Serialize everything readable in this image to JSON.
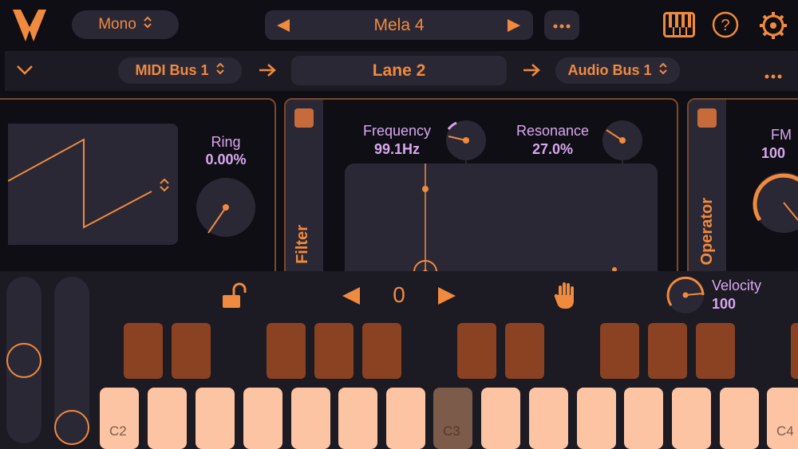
{
  "header": {
    "mode": "Mono",
    "preset": "Mela 4",
    "icons": [
      "logo-icon",
      "piano-icon",
      "help-icon",
      "settings-icon"
    ]
  },
  "routing": {
    "midi_bus": "MIDI Bus 1",
    "lane": "Lane 2",
    "audio_bus": "Audio Bus 1"
  },
  "oscillator": {
    "ring_label": "Ring",
    "ring_value": "0.00%"
  },
  "filter": {
    "section_label": "Filter",
    "frequency_label": "Frequency",
    "frequency_value": "99.1Hz",
    "resonance_label": "Resonance",
    "resonance_value": "27.0%"
  },
  "operator": {
    "section_label": "Operator",
    "fm_label": "FM",
    "fm_value": "100"
  },
  "keyboard_controls": {
    "octave": "0",
    "velocity_label": "Velocity",
    "velocity_value": "100"
  },
  "keys": {
    "c2": "C2",
    "c3": "C3",
    "c4": "C4"
  },
  "colors": {
    "accent": "#f08a3e",
    "background": "#0f0e14",
    "panel": "#2b2836",
    "white_key": "#fdc4a4",
    "black_key": "#8b4222",
    "label_lavender": "#d8a8f0"
  }
}
